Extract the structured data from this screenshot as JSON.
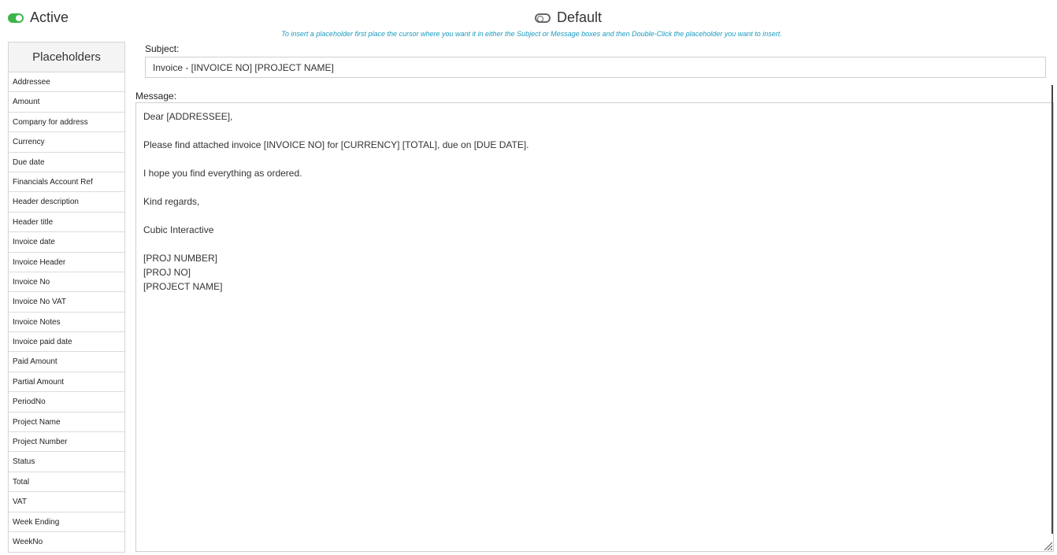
{
  "active_toggle": {
    "label": "Active",
    "checked": true,
    "color": "#3cb44a"
  },
  "default_toggle": {
    "label": "Default",
    "checked": false
  },
  "hint": "To insert a placeholder first place the cursor where you want it in either the Subject or Message boxes and then Double-Click the placeholder you want to insert.",
  "placeholders": {
    "title": "Placeholders",
    "items": [
      "Addressee",
      "Amount",
      "Company for address",
      "Currency",
      "Due date",
      "Financials Account Ref",
      "Header description",
      "Header title",
      "Invoice date",
      "Invoice Header",
      "Invoice No",
      "Invoice No VAT",
      "Invoice Notes",
      "Invoice paid date",
      "Paid Amount",
      "Partial Amount",
      "PeriodNo",
      "Project Name",
      "Project Number",
      "Status",
      "Total",
      "VAT",
      "Week Ending",
      "WeekNo"
    ]
  },
  "subject": {
    "label": "Subject:",
    "value": "Invoice - [INVOICE NO] [PROJECT NAME]"
  },
  "message": {
    "label": "Message:",
    "lines": [
      "Dear [ADDRESSEE],",
      "",
      "Please find attached invoice [INVOICE NO] for [CURRENCY] [TOTAL], due on [DUE DATE].",
      "",
      "I hope you find everything as ordered.",
      "",
      "Kind regards,",
      "",
      "Cubic Interactive",
      "",
      "[PROJ NUMBER]",
      "[PROJ NO]",
      "[PROJECT NAME]"
    ]
  }
}
